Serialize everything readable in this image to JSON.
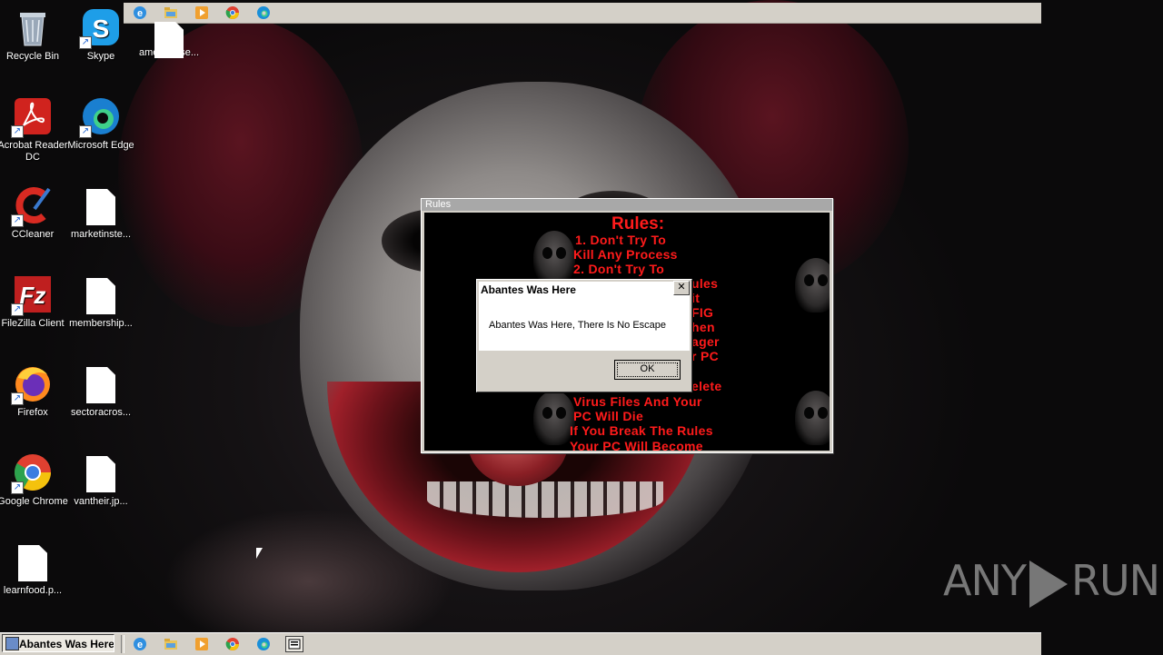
{
  "desktop": {
    "icons": [
      {
        "label": "Recycle Bin",
        "icon": "recycle-bin-icon"
      },
      {
        "label": "Skype",
        "icon": "skype-icon"
      },
      {
        "label": "americanse...",
        "icon": "file-icon"
      },
      {
        "label": "Acrobat Reader DC",
        "icon": "acrobat-icon"
      },
      {
        "label": "Microsoft Edge",
        "icon": "edge-icon"
      },
      {
        "label": "CCleaner",
        "icon": "ccleaner-icon"
      },
      {
        "label": "marketinste...",
        "icon": "file-icon"
      },
      {
        "label": "FileZilla Client",
        "icon": "filezilla-icon"
      },
      {
        "label": "membership...",
        "icon": "file-icon"
      },
      {
        "label": "Firefox",
        "icon": "firefox-icon"
      },
      {
        "label": "sectoracros...",
        "icon": "file-icon"
      },
      {
        "label": "Google Chrome",
        "icon": "chrome-icon"
      },
      {
        "label": "vantheir.jp...",
        "icon": "file-icon"
      },
      {
        "label": "learnfood.p...",
        "icon": "file-icon"
      }
    ]
  },
  "rules_window": {
    "title": "Rules",
    "heading": "Rules:",
    "lines": [
      "1. Don't Try To",
      "Kill Any Process",
      "2. Don't Try To",
      "ules",
      "it",
      "FIG",
      "hen",
      "ager",
      "r PC",
      "elete",
      "Virus Files And Your",
      "PC Will Die",
      "If You Break The Rules",
      "Your PC Will Become"
    ]
  },
  "message_box": {
    "title": "Abantes Was Here",
    "close_glyph": "✕",
    "message": "Abantes Was Here, There Is No Escape",
    "ok_label": "OK"
  },
  "taskbar": {
    "active_task": "Abantes Was Here",
    "quicklaunch": [
      "ie-icon",
      "explorer-icon",
      "media-player-icon",
      "chrome-icon",
      "edge-icon"
    ]
  },
  "watermark": {
    "left": "ANY",
    "right": "RUN"
  },
  "colors": {
    "rules_text": "#ff1b1b",
    "title_inactive": "#a8a8a8",
    "taskbar": "#d4d0c8"
  }
}
